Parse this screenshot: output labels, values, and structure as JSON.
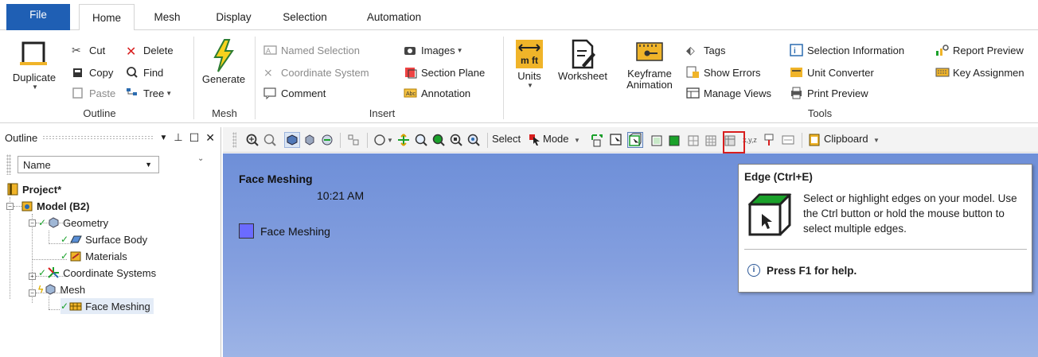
{
  "tabs": [
    {
      "label": "File"
    },
    {
      "label": "Home"
    },
    {
      "label": "Mesh"
    },
    {
      "label": "Display"
    },
    {
      "label": "Selection"
    },
    {
      "label": "Automation"
    }
  ],
  "ribbon": {
    "outline": {
      "duplicate": "Duplicate",
      "cut": "Cut",
      "copy": "Copy",
      "paste": "Paste",
      "delete": "Delete",
      "find": "Find",
      "tree": "Tree",
      "label": "Outline"
    },
    "mesh": {
      "generate": "Generate",
      "label": "Mesh"
    },
    "insert": {
      "named_selection": "Named Selection",
      "coordinate_system": "Coordinate System",
      "comment": "Comment",
      "images": "Images",
      "section_plane": "Section Plane",
      "annotation": "Annotation",
      "label": "Insert"
    },
    "tools": {
      "units": "Units",
      "worksheet": "Worksheet",
      "keyframe_1": "Keyframe",
      "keyframe_2": "Animation",
      "tags": "Tags",
      "show_errors": "Show Errors",
      "manage_views": "Manage Views",
      "selection_information": "Selection Information",
      "unit_converter": "Unit Converter",
      "print_preview": "Print Preview",
      "report_preview": "Report Preview",
      "key_assignments": "Key Assignmen",
      "label": "Tools",
      "units_icon_text": "m ft"
    }
  },
  "outline_panel": {
    "title": "Outline",
    "name_column": "Name",
    "tree": [
      {
        "label": "Project*"
      },
      {
        "label": "Model (B2)"
      },
      {
        "label": "Geometry"
      },
      {
        "label": "Surface Body"
      },
      {
        "label": "Materials"
      },
      {
        "label": "Coordinate Systems"
      },
      {
        "label": "Mesh"
      },
      {
        "label": "Face Meshing"
      }
    ]
  },
  "toolbar": {
    "select_label": "Select",
    "mode_label": "Mode",
    "clipboard_label": "Clipboard",
    "xyz_label": "x,y,z",
    "abc_label": "Abc"
  },
  "viewport": {
    "title": "Face Meshing",
    "time": "10:21 AM",
    "legend_label": "Face Meshing",
    "legend_color": "#6b6bff"
  },
  "tooltip": {
    "title": "Edge (Ctrl+E)",
    "body": "Select or highlight edges on your model. Use the Ctrl button or hold the mouse button to select multiple edges.",
    "help": "Press F1 for help."
  },
  "colors": {
    "file_tab": "#1f5fb4",
    "highlight": "#d81e1e",
    "viewport_top": "#6e8fd8",
    "viewport_bottom": "#9db4e6"
  }
}
